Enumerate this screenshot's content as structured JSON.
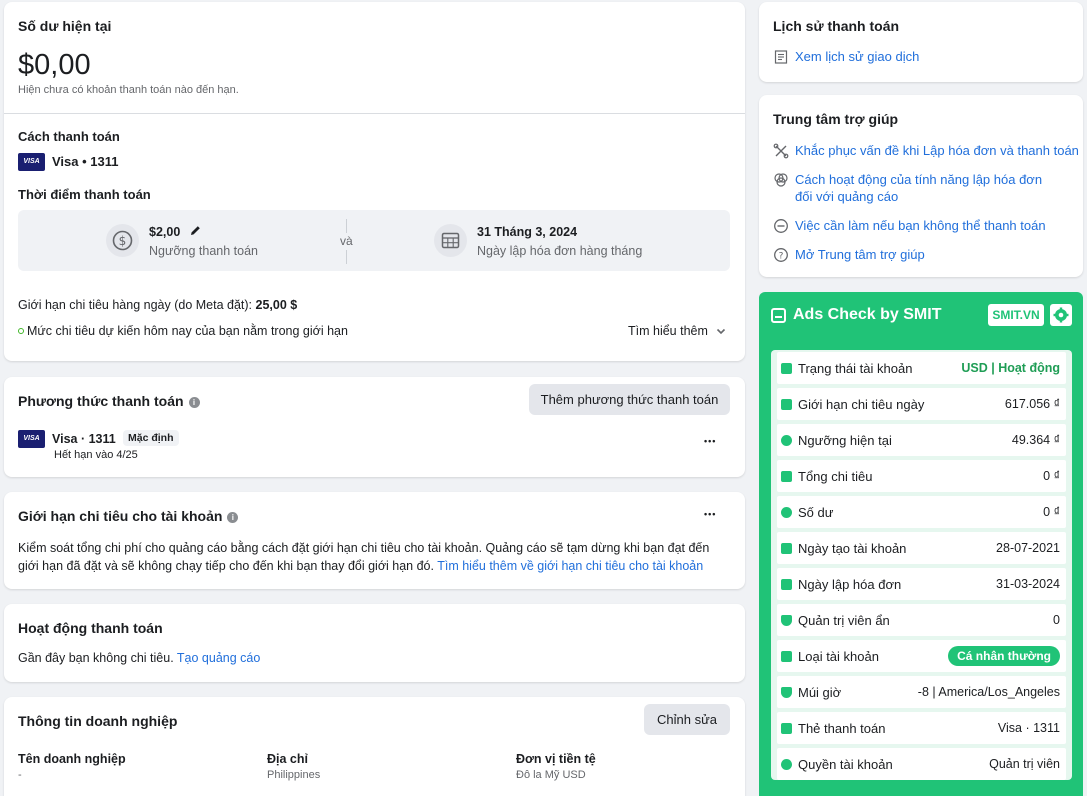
{
  "balance": {
    "title": "Số dư hiện tại",
    "amount": "$0,00",
    "note": "Hiện chưa có khoản thanh toán nào đến hạn.",
    "method_title": "Cách thanh toán",
    "visa_logo": "VISA",
    "method_value": "Visa • 1311",
    "time_title": "Thời điểm thanh toán",
    "threshold_value": "$2,00",
    "threshold_label": "Ngưỡng thanh toán",
    "and_label": "và",
    "billing_date": "31 Tháng 3, 2024",
    "billing_label": "Ngày lập hóa đơn hàng tháng",
    "daily_limit_label": "Giới hạn chi tiêu hàng ngày (do Meta đặt): ",
    "daily_limit_value": "25,00 $",
    "status_text": "Mức chi tiêu dự kiến hôm nay của bạn nằm trong giới hạn",
    "learn_more": "Tìm hiểu thêm"
  },
  "payment_methods": {
    "title": "Phương thức thanh toán",
    "add_button": "Thêm phương thức thanh toán",
    "visa_logo": "VISA",
    "card": "Visa · 1311",
    "default_badge": "Mặc định",
    "expiry": "Hết hạn vào 4/25",
    "more": "•••"
  },
  "account_limit": {
    "title": "Giới hạn chi tiêu cho tài khoản",
    "more": "•••",
    "description": "Kiểm soát tổng chi phí cho quảng cáo bằng cách đặt giới hạn chi tiêu cho tài khoản. Quảng cáo sẽ tạm dừng khi bạn đạt đến giới hạn đã đặt và sẽ không chạy tiếp cho đến khi bạn thay đổi giới hạn đó. ",
    "link": "Tìm hiểu thêm về giới hạn chi tiêu cho tài khoản"
  },
  "activity": {
    "title": "Hoạt động thanh toán",
    "text": "Gần đây bạn không chi tiêu. ",
    "link": "Tạo quảng cáo"
  },
  "business": {
    "title": "Thông tin doanh nghiệp",
    "edit_button": "Chỉnh sửa",
    "name_label": "Tên doanh nghiệp",
    "name_value": "-",
    "address_label": "Địa chỉ",
    "address_value": "Philippines",
    "currency_label": "Đơn vị tiền tệ",
    "currency_value": "Đô la Mỹ USD"
  },
  "history": {
    "title": "Lịch sử thanh toán",
    "link": "Xem lịch sử giao dịch"
  },
  "help": {
    "title": "Trung tâm trợ giúp",
    "items": [
      {
        "label": "Khắc phục vấn đề khi Lập hóa đơn và thanh toán",
        "icon": "wrench-icon"
      },
      {
        "label": "Cách hoạt động của tính năng lập hóa đơn đối với quảng cáo",
        "icon": "venn-icon"
      },
      {
        "label": "Việc cần làm nếu bạn không thể thanh toán",
        "icon": "minus-circle-icon"
      },
      {
        "label": "Mở Trung tâm trợ giúp",
        "icon": "question-icon"
      }
    ]
  },
  "smit": {
    "title": "Ads Check by SMIT",
    "site_button": "SMIT.VN",
    "rows": [
      {
        "label": "Trạng thái tài khoản",
        "value": "USD | Hoạt động"
      },
      {
        "label": "Giới hạn chi tiêu ngày",
        "value": "617.056 ₫"
      },
      {
        "label": "Ngưỡng hiện tại",
        "value": "49.364 ₫"
      },
      {
        "label": "Tổng chi tiêu",
        "value": "0 ₫"
      },
      {
        "label": "Số dư",
        "value": "0 ₫"
      },
      {
        "label": "Ngày tạo tài khoản",
        "value": "28-07-2021"
      },
      {
        "label": "Ngày lập hóa đơn",
        "value": "31-03-2024"
      },
      {
        "label": "Quản trị viên ẩn",
        "value": "0"
      },
      {
        "label": "Loại tài khoản",
        "value": "Cá nhân thường"
      },
      {
        "label": "Múi giờ",
        "value": "-8 | America/Los_Angeles"
      },
      {
        "label": "Thẻ thanh toán",
        "value": "Visa · 1311"
      },
      {
        "label": "Quyền tài khoản",
        "value": "Quản trị viên"
      }
    ]
  },
  "colors": {
    "link": "#216fdb",
    "smit_green": "#20c377",
    "status_green": "#1f9d55"
  }
}
